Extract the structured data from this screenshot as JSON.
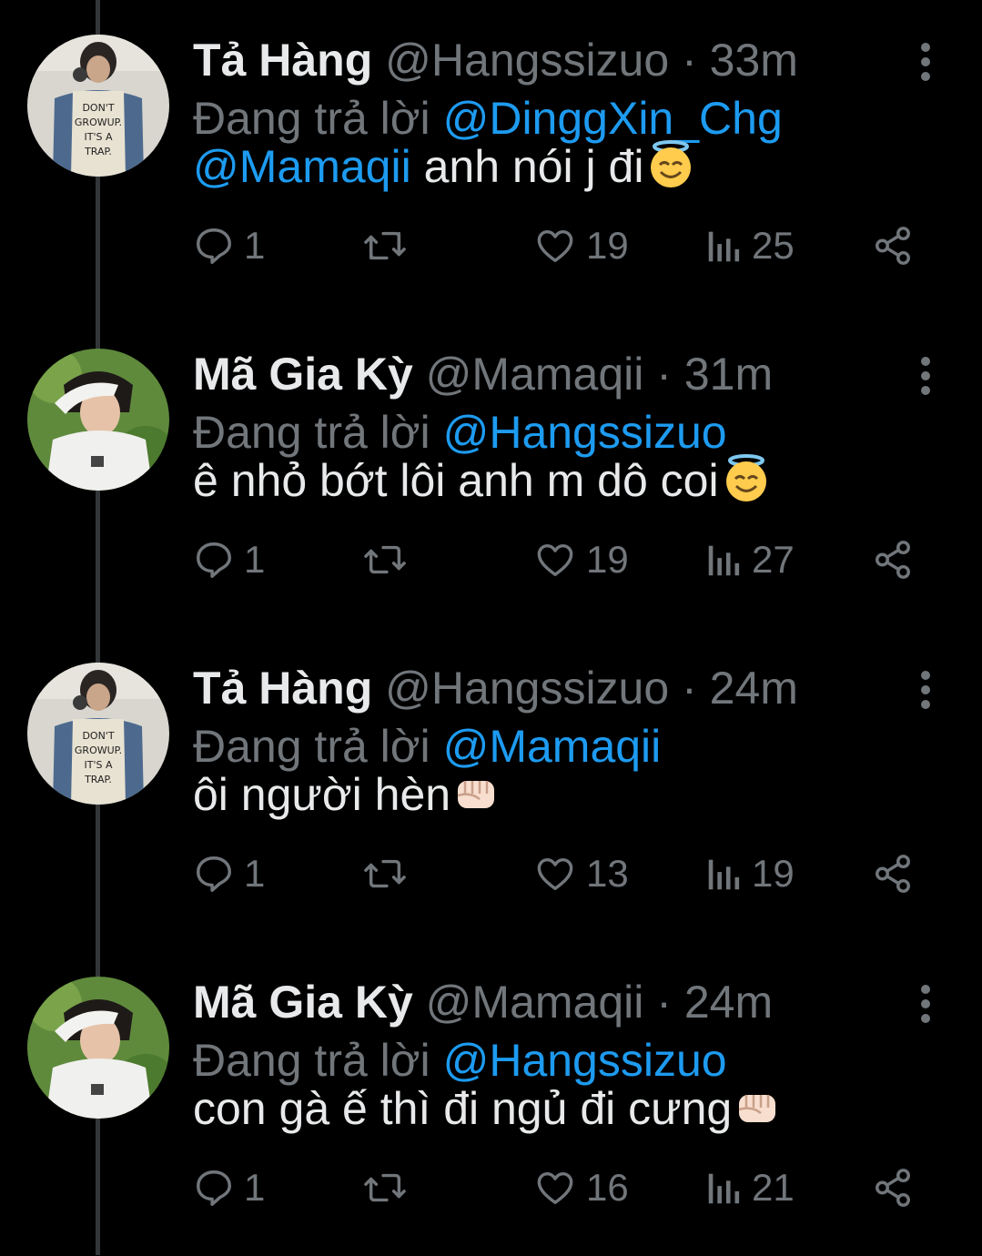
{
  "reply_prefix": "Đang trả lời",
  "tweets": [
    {
      "name": "Tả Hàng",
      "handle": "@Hangssizuo",
      "separator": "·",
      "time": "33m",
      "reply_to": "@DinggXin_Chg",
      "mention": "@Mamaqii",
      "text": " anh nói j đi",
      "emoji": "smiling-face-with-halo",
      "replies": "1",
      "likes": "19",
      "views": "25"
    },
    {
      "name": "Mã Gia Kỳ",
      "handle": "@Mamaqii",
      "separator": "·",
      "time": "31m",
      "reply_to": "@Hangssizuo",
      "mention": "",
      "text": "ê nhỏ bớt lôi anh m dô coi",
      "emoji": "smiling-face-with-halo",
      "replies": "1",
      "likes": "19",
      "views": "27"
    },
    {
      "name": "Tả Hàng",
      "handle": "@Hangssizuo",
      "separator": "·",
      "time": "24m",
      "reply_to": "@Mamaqii",
      "mention": "",
      "text": "ôi người hèn",
      "emoji": "oncoming-fist",
      "replies": "1",
      "likes": "13",
      "views": "19"
    },
    {
      "name": "Mã Gia Kỳ",
      "handle": "@Mamaqii",
      "separator": "·",
      "time": "24m",
      "reply_to": "@Hangssizuo",
      "mention": "",
      "text": "con gà ế thì đi ngủ đi cưng",
      "emoji": "oncoming-fist",
      "replies": "1",
      "likes": "16",
      "views": "21"
    }
  ],
  "avatar_text": [
    "DON'T",
    "GROWUP.",
    "IT'S A",
    "TRAP."
  ],
  "colors": {
    "background": "#000000",
    "primary_text": "#e7e9ea",
    "secondary_text": "#71767b",
    "link": "#1d9bf0",
    "thread_line": "#333639"
  }
}
